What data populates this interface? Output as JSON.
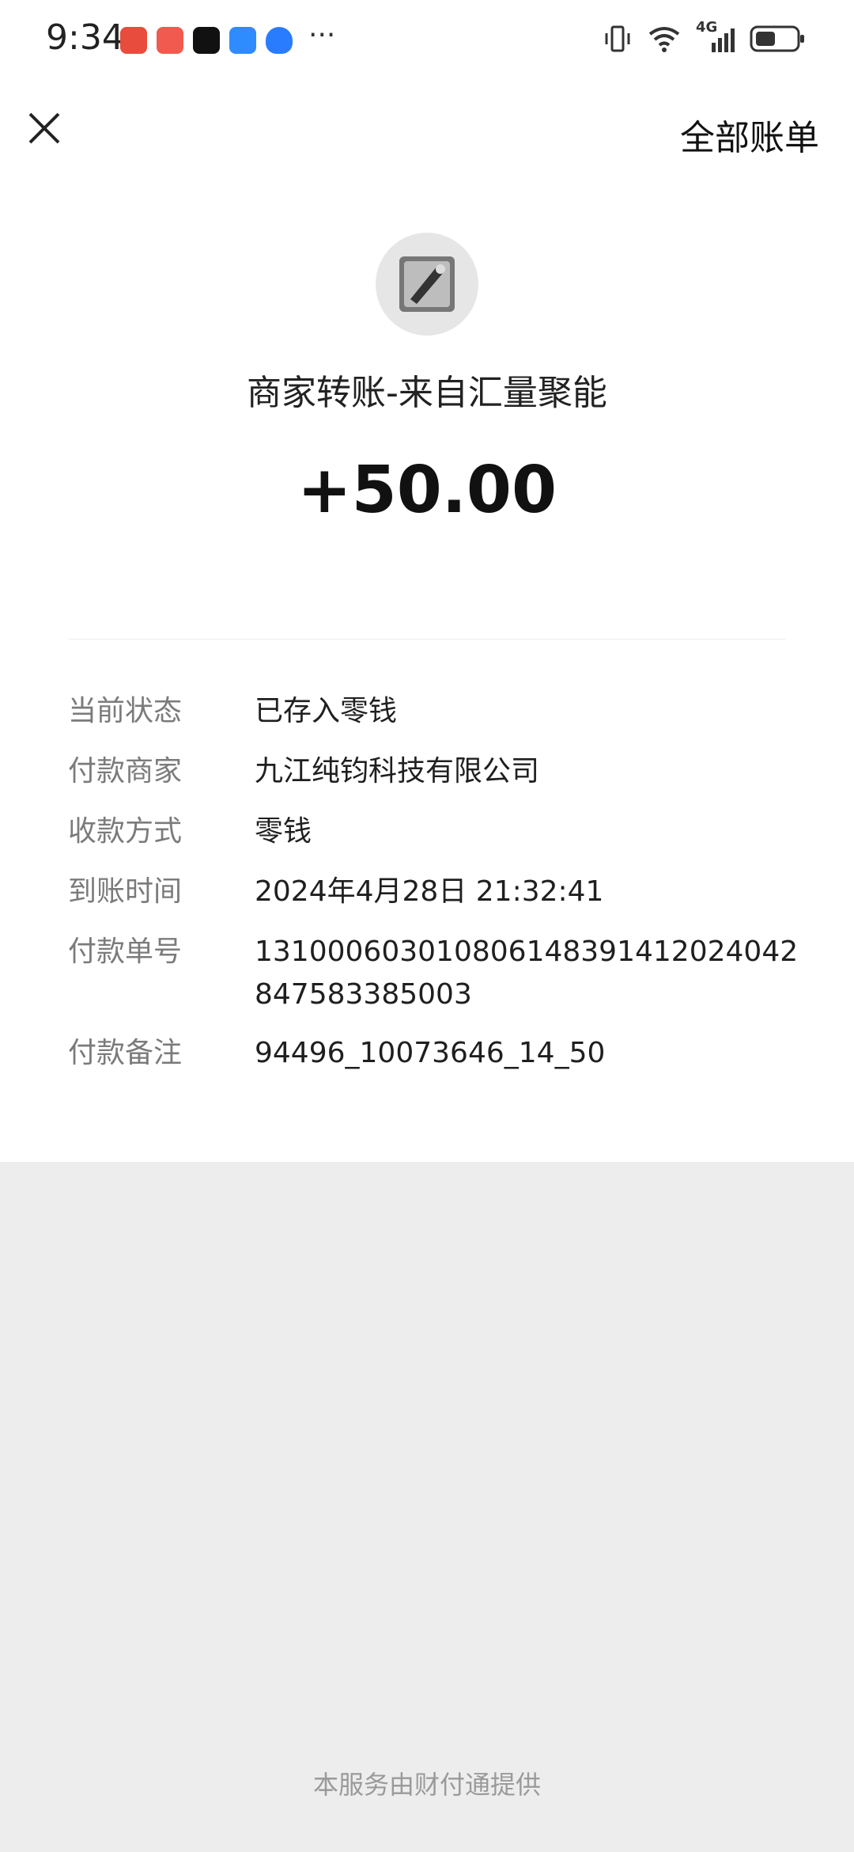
{
  "status_bar": {
    "time": "9:34",
    "network": "4G",
    "app_icons": [
      "phone-app-icon",
      "huawei-app-icon",
      "tiktok-app-icon",
      "message-app-icon",
      "shield-app-icon"
    ],
    "more": "···"
  },
  "nav": {
    "right_label": "全部账单"
  },
  "transaction": {
    "title": "商家转账-来自汇量聚能",
    "amount": "+50.00"
  },
  "details": [
    {
      "label": "当前状态",
      "value": "已存入零钱"
    },
    {
      "label": "付款商家",
      "value": "九江纯钧科技有限公司"
    },
    {
      "label": "收款方式",
      "value": "零钱"
    },
    {
      "label": "到账时间",
      "value": "2024年4月28日 21:32:41"
    },
    {
      "label": "付款单号",
      "value": "131000603010806148391412024042847583385003"
    },
    {
      "label": "付款备注",
      "value": "94496_10073646_14_50"
    }
  ],
  "footer": {
    "text": "本服务由财付通提供"
  },
  "colors": {
    "background": "#ededed",
    "card": "#ffffff",
    "label": "#7b7b7b",
    "value": "#1f1f1f"
  }
}
